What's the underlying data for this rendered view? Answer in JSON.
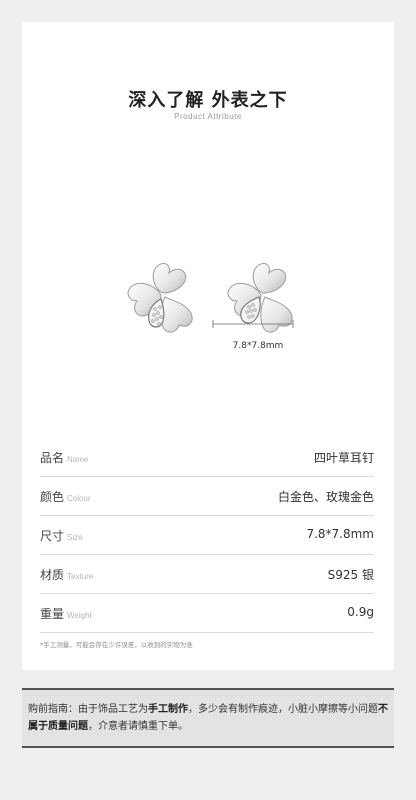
{
  "header": {
    "title": "深入了解 外表之下",
    "subtitle": "Product Attribute"
  },
  "product": {
    "dimension": "7.8*7.8mm",
    "image_icon": "four-leaf-clover-earring-icon"
  },
  "specs": [
    {
      "label": "品名",
      "label_en": "Name",
      "value": "四叶草耳钉"
    },
    {
      "label": "颜色",
      "label_en": "Colour",
      "value": "白金色、玫瑰金色"
    },
    {
      "label": "尺寸",
      "label_en": "Size",
      "value": "7.8*7.8mm"
    },
    {
      "label": "材质",
      "label_en": "Texture",
      "value": "S925 银"
    },
    {
      "label": "重量",
      "label_en": "Weight",
      "value": "0.9g"
    }
  ],
  "footnote": "*手工测量，可能会存在少许误差，以收到的实物为准",
  "notice": {
    "p1": "购前指南：由于饰品工艺为",
    "b1": "手工制作",
    "p2": "，多少会有制作痕迹，小脏小摩擦等小问题",
    "b2": "不属于质量问题",
    "p3": "，介意者请慎重下单。"
  },
  "colors": {
    "background": "#efefef",
    "card": "#ffffff",
    "notice_bg": "#e3e3e3",
    "notice_border": "#545454"
  }
}
